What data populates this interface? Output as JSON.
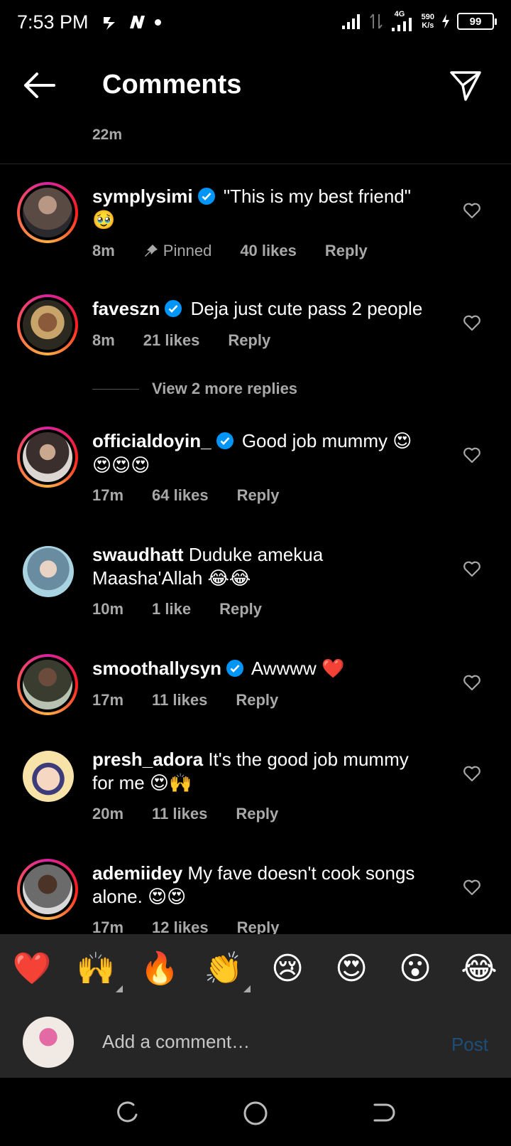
{
  "status": {
    "time": "7:53 PM",
    "network_rate": "590",
    "network_unit": "K/s",
    "net_type": "4G",
    "battery": "99"
  },
  "header": {
    "title": "Comments"
  },
  "top_time": "22m",
  "comments": [
    {
      "user": "symplysimi",
      "verified": true,
      "text": "\"This is my best friend\"",
      "emoji": "🥹",
      "time": "8m",
      "pinned": "Pinned",
      "likes": "40 likes",
      "reply": "Reply"
    },
    {
      "user": "faveszn",
      "verified": true,
      "text": "Deja just cute pass 2 people",
      "emoji": "",
      "time": "8m",
      "likes": "21 likes",
      "reply": "Reply"
    },
    {
      "user": "officialdoyin_",
      "verified": true,
      "text": "Good job mummy",
      "emoji": "😍",
      "emoji2": "😍😍😍",
      "time": "17m",
      "likes": "64 likes",
      "reply": "Reply"
    },
    {
      "user": "swaudhatt",
      "verified": false,
      "text": "Duduke amekua",
      "text2": "Maasha'Allah",
      "emoji": "😂😂",
      "time": "10m",
      "likes": "1 like",
      "reply": "Reply"
    },
    {
      "user": "smoothallysyn",
      "verified": true,
      "text": "Awwww",
      "emoji": "❤️",
      "time": "17m",
      "likes": "11 likes",
      "reply": "Reply"
    },
    {
      "user": "presh_adora",
      "verified": false,
      "text": "It's the good job mummy",
      "text2": "for me",
      "emoji": "😍🙌",
      "time": "20m",
      "likes": "11 likes",
      "reply": "Reply"
    },
    {
      "user": "ademiidey",
      "verified": false,
      "text": "My fave doesn't cook songs",
      "text2": "alone.",
      "emoji": "😍😍",
      "time": "17m",
      "likes": "12 likes",
      "reply": "Reply"
    }
  ],
  "view_replies": "View 2 more replies",
  "quick_emojis": [
    "❤️",
    "🙌",
    "🔥",
    "👏",
    "😢",
    "😍",
    "😮",
    "😂"
  ],
  "input": {
    "placeholder": "Add a comment…",
    "post_label": "Post"
  },
  "colors": {
    "background": "#000000",
    "muted": "#a8a8a8",
    "verified": "#0095f6",
    "post_disabled": "#1d4e78",
    "panel": "#262626"
  }
}
